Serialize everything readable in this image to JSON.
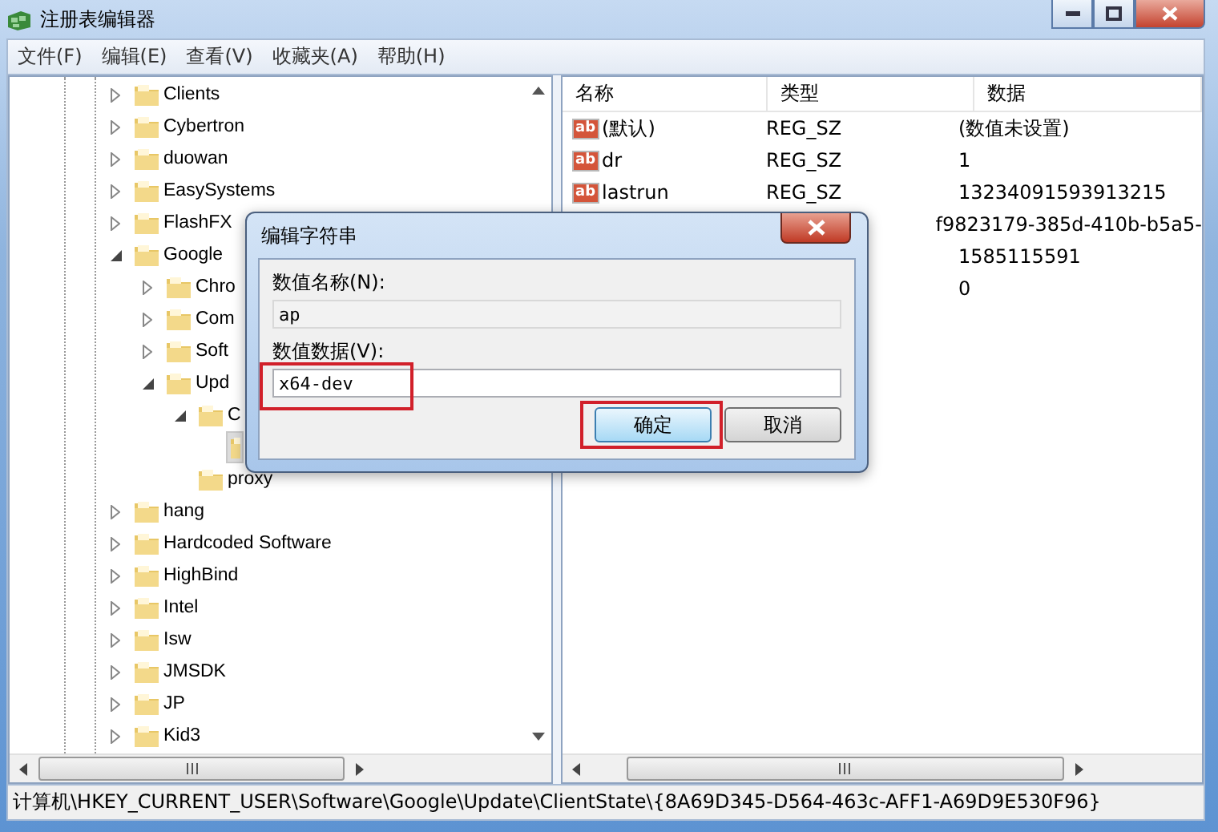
{
  "window": {
    "title": "注册表编辑器"
  },
  "menu": [
    "文件(F)",
    "编辑(E)",
    "查看(V)",
    "收藏夹(A)",
    "帮助(H)"
  ],
  "tree": [
    {
      "label": "Clients",
      "expanded": false,
      "selected": false
    },
    {
      "label": "Cybertron",
      "expanded": false,
      "selected": false
    },
    {
      "label": "duowan",
      "expanded": false,
      "selected": false
    },
    {
      "label": "EasySystems",
      "expanded": false,
      "selected": false
    },
    {
      "label": "FlashFX",
      "expanded": false,
      "selected": false
    },
    {
      "label": "Google",
      "expanded": true,
      "selected": false,
      "children": [
        {
          "label": "Chro",
          "expanded": false,
          "selected": false
        },
        {
          "label": "Com",
          "expanded": false,
          "selected": false
        },
        {
          "label": "Soft",
          "expanded": false,
          "selected": false
        },
        {
          "label": "Upd",
          "expanded": true,
          "selected": false,
          "children": [
            {
              "label": "C",
              "expanded": true,
              "selected": false,
              "children": [
                {
                  "selected": true
                }
              ]
            },
            {
              "label": "proxy",
              "selected": false
            }
          ]
        }
      ]
    },
    {
      "label": "hang",
      "expanded": false,
      "selected": false
    },
    {
      "label": "Hardcoded Software",
      "expanded": false,
      "selected": false
    },
    {
      "label": "HighBind",
      "expanded": false,
      "selected": false
    },
    {
      "label": "Intel",
      "expanded": false,
      "selected": false
    },
    {
      "label": "Isw",
      "expanded": false,
      "selected": false
    },
    {
      "label": "JMSDK",
      "expanded": false,
      "selected": false
    },
    {
      "label": "JP",
      "expanded": false,
      "selected": false
    },
    {
      "label": "Kid3",
      "expanded": false,
      "selected": false
    }
  ],
  "values": {
    "columns": [
      "名称",
      "类型",
      "数据"
    ],
    "rows": [
      {
        "icon": "ab",
        "name": "(默认)",
        "type": "REG_SZ",
        "data": "(数值未设置)"
      },
      {
        "icon": "ab",
        "name": "dr",
        "type": "REG_SZ",
        "data": "1"
      },
      {
        "icon": "ab",
        "name": "lastrun",
        "type": "REG_SZ",
        "data": "13234091593913215"
      },
      {
        "data": "f9823179-385d-410b-b5a5-"
      },
      {
        "data": "1585115591"
      },
      {
        "data": "0"
      }
    ]
  },
  "dialog": {
    "title": "编辑字符串",
    "name_field": {
      "label": "数值名称(N):",
      "value": "ap"
    },
    "data_field": {
      "label": "数值数据(V):",
      "value": "x64-dev",
      "highlighted": true
    },
    "buttons": [
      {
        "label": "确定",
        "default": true,
        "highlighted": true
      },
      {
        "label": "取消",
        "default": false
      }
    ]
  },
  "status_bar": "计算机\\HKEY_CURRENT_USER\\Software\\Google\\Update\\ClientState\\{8A69D345-D564-463c-AFF1-A69D9E530F96}"
}
